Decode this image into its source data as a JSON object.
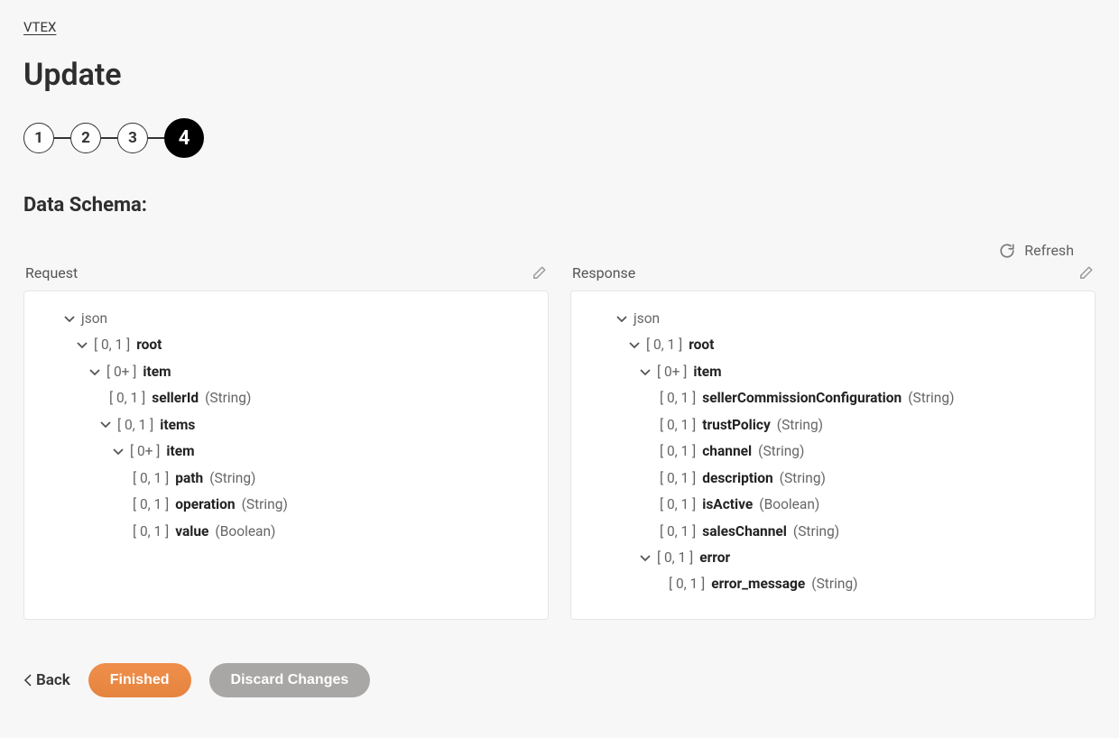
{
  "breadcrumb": {
    "root": "VTEX"
  },
  "page": {
    "title": "Update"
  },
  "stepper": {
    "steps": [
      "1",
      "2",
      "3",
      "4"
    ],
    "active_index": 3
  },
  "section": {
    "heading": "Data Schema:"
  },
  "actions": {
    "refresh": "Refresh",
    "back": "Back",
    "finished": "Finished",
    "discard": "Discard Changes"
  },
  "request": {
    "label": "Request",
    "tree": {
      "n0": {
        "text": "json"
      },
      "n1": {
        "card": "[ 0, 1 ]",
        "name": "root"
      },
      "n2": {
        "card": "[ 0+ ]",
        "name": "item"
      },
      "n3": {
        "card": "[ 0, 1 ]",
        "name": "sellerId",
        "type": "(String)"
      },
      "n4": {
        "card": "[ 0, 1 ]",
        "name": "items"
      },
      "n5": {
        "card": "[ 0+ ]",
        "name": "item"
      },
      "n6": {
        "card": "[ 0, 1 ]",
        "name": "path",
        "type": "(String)"
      },
      "n7": {
        "card": "[ 0, 1 ]",
        "name": "operation",
        "type": "(String)"
      },
      "n8": {
        "card": "[ 0, 1 ]",
        "name": "value",
        "type": "(Boolean)"
      }
    }
  },
  "response": {
    "label": "Response",
    "tree": {
      "n0": {
        "text": "json"
      },
      "n1": {
        "card": "[ 0, 1 ]",
        "name": "root"
      },
      "n2": {
        "card": "[ 0+ ]",
        "name": "item"
      },
      "n3": {
        "card": "[ 0, 1 ]",
        "name": "sellerCommissionConfiguration",
        "type": "(String)"
      },
      "n4": {
        "card": "[ 0, 1 ]",
        "name": "trustPolicy",
        "type": "(String)"
      },
      "n5": {
        "card": "[ 0, 1 ]",
        "name": "channel",
        "type": "(String)"
      },
      "n6": {
        "card": "[ 0, 1 ]",
        "name": "description",
        "type": "(String)"
      },
      "n7": {
        "card": "[ 0, 1 ]",
        "name": "isActive",
        "type": "(Boolean)"
      },
      "n8": {
        "card": "[ 0, 1 ]",
        "name": "salesChannel",
        "type": "(String)"
      },
      "n9": {
        "card": "[ 0, 1 ]",
        "name": "error"
      },
      "n10": {
        "card": "[ 0, 1 ]",
        "name": "error_message",
        "type": "(String)"
      }
    }
  }
}
